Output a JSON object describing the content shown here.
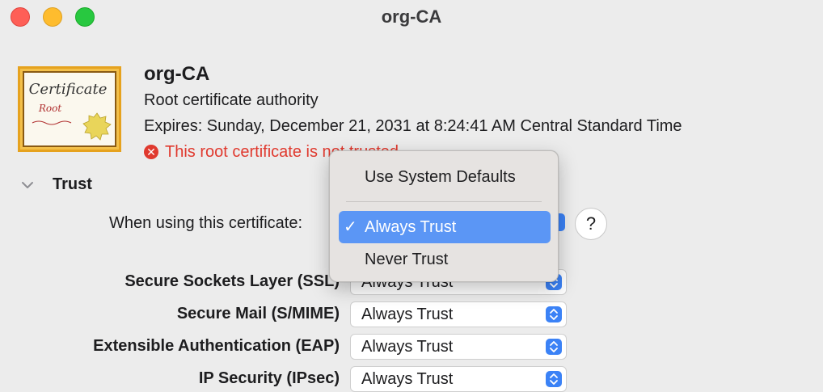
{
  "window": {
    "title": "org-CA"
  },
  "certificate": {
    "name": "org-CA",
    "type": "Root certificate authority",
    "expires": "Expires: Sunday, December 21, 2031 at 8:24:41 AM Central Standard Time",
    "status": "This root certificate is not trusted",
    "icon_title": "Certificate",
    "icon_subtitle": "Root"
  },
  "trust": {
    "heading": "Trust",
    "when_using_label": "When using this certificate:",
    "help_label": "?",
    "rows": [
      {
        "label": "Secure Sockets Layer (SSL)",
        "value": "Always Trust"
      },
      {
        "label": "Secure Mail (S/MIME)",
        "value": "Always Trust"
      },
      {
        "label": "Extensible Authentication (EAP)",
        "value": "Always Trust"
      },
      {
        "label": "IP Security (IPsec)",
        "value": "Always Trust"
      }
    ]
  },
  "popup_menu": {
    "items": [
      {
        "label": "Use System Defaults",
        "selected": false
      },
      {
        "label": "Always Trust",
        "selected": true
      },
      {
        "label": "Never Trust",
        "selected": false
      }
    ],
    "checkmark": "✓"
  },
  "colors": {
    "accent": "#3b82f6",
    "menu_highlight": "#5b96f5",
    "error": "#e0392e"
  }
}
